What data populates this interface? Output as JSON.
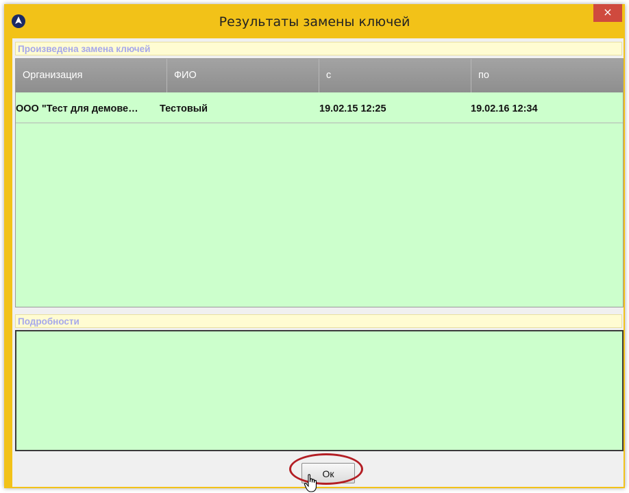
{
  "window": {
    "title": "Результаты замены ключей",
    "close_glyph": "×",
    "app_icon": "app-logo-icon"
  },
  "results": {
    "label": "Произведена замена ключей",
    "columns": [
      "Организация",
      "ФИО",
      "с",
      "по"
    ],
    "rows": [
      [
        "ООО \"Тест для демове…",
        "Тестовый",
        "19.02.15 12:25",
        "19.02.16 12:34"
      ]
    ]
  },
  "details": {
    "label": "Подробности",
    "text": ""
  },
  "footer": {
    "ok_label": "Ок"
  },
  "colors": {
    "window_frame": "#f2c218",
    "grid_background": "#ccffcc",
    "header_background": "#999999",
    "label_background": "#fffcd2",
    "label_text": "#a6a8ea",
    "close_button": "#cf4a3e",
    "highlight_ring": "#b31e24"
  }
}
